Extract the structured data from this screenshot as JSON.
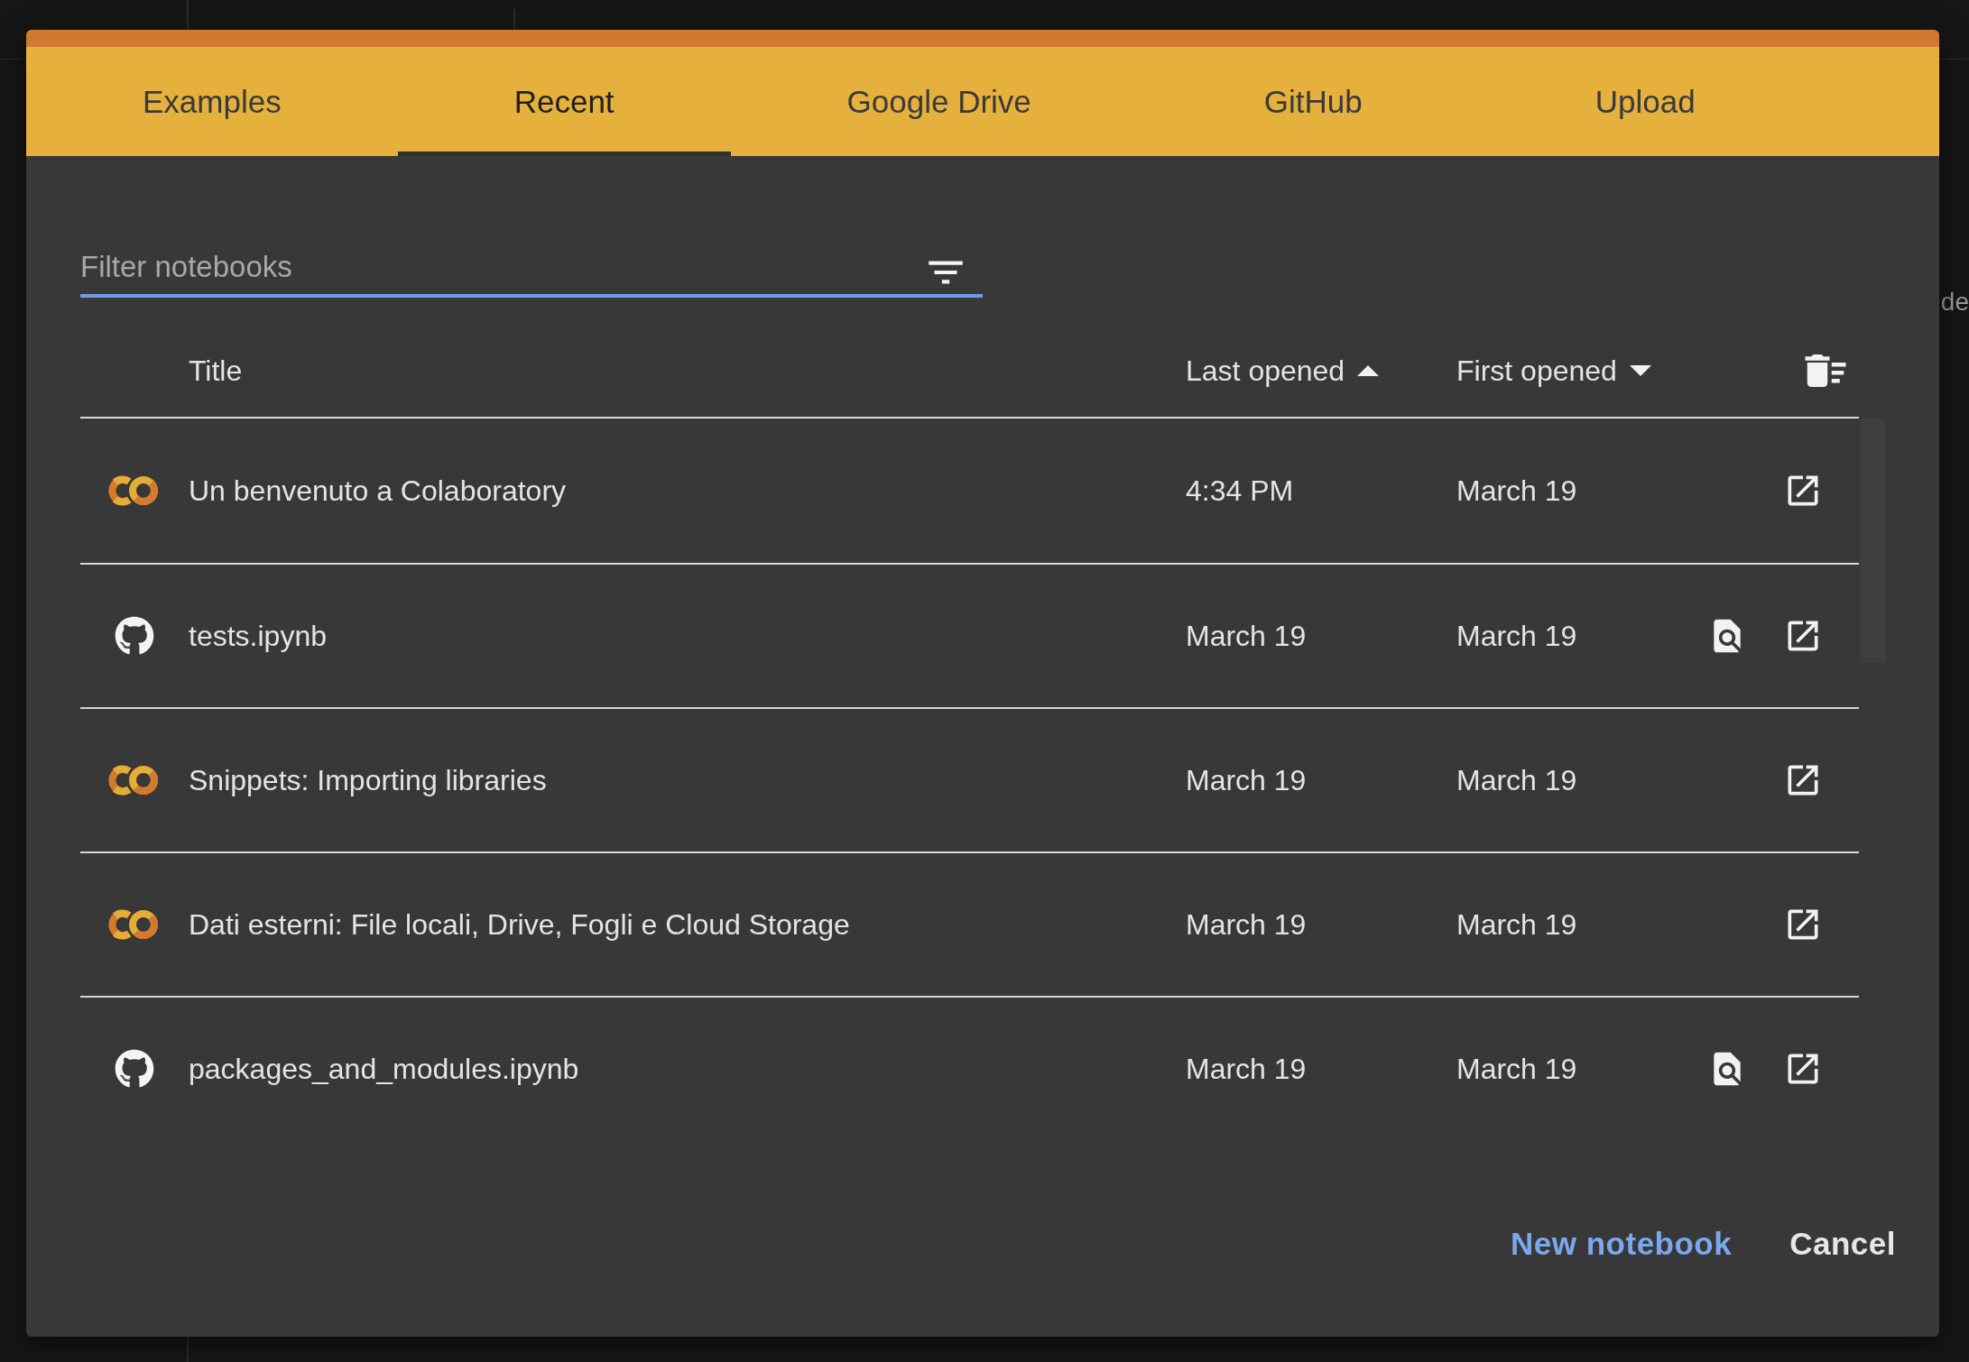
{
  "background": {
    "side_text": "de"
  },
  "dialog": {
    "tabs": [
      {
        "label": "Examples",
        "selected": false
      },
      {
        "label": "Recent",
        "selected": true
      },
      {
        "label": "Google Drive",
        "selected": false
      },
      {
        "label": "GitHub",
        "selected": false
      },
      {
        "label": "Upload",
        "selected": false
      }
    ],
    "filter": {
      "placeholder": "Filter notebooks"
    },
    "columns": [
      {
        "label": "Title"
      },
      {
        "label": "Last opened",
        "ascending": true
      },
      {
        "label": "First opened",
        "ascending": false
      }
    ],
    "rows": [
      {
        "kind": "colab",
        "title": "Un benvenuto a Colaboratory",
        "last_opened": "4:34 PM",
        "first_opened": "March 19",
        "preview": false
      },
      {
        "kind": "github",
        "title": "tests.ipynb",
        "last_opened": "March 19",
        "first_opened": "March 19",
        "preview": true
      },
      {
        "kind": "colab",
        "title": "Snippets: Importing libraries",
        "last_opened": "March 19",
        "first_opened": "March 19",
        "preview": false
      },
      {
        "kind": "colab",
        "title": "Dati esterni: File locali, Drive, Fogli e Cloud Storage",
        "last_opened": "March 19",
        "first_opened": "March 19",
        "preview": false
      },
      {
        "kind": "github",
        "title": "packages_and_modules.ipynb",
        "last_opened": "March 19",
        "first_opened": "March 19",
        "preview": true
      }
    ],
    "buttons": [
      {
        "kind": "primary",
        "label": "New notebook"
      },
      {
        "kind": "plain",
        "label": "Cancel"
      }
    ]
  }
}
